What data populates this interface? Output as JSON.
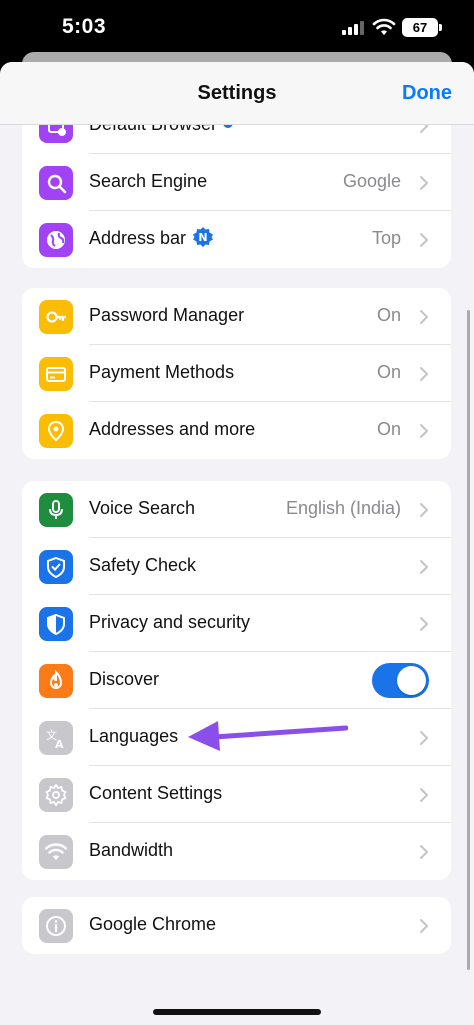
{
  "status_bar": {
    "time": "5:03",
    "battery": "67"
  },
  "nav": {
    "title": "Settings",
    "done_label": "Done"
  },
  "groups": [
    [
      {
        "label": "Default Browser",
        "value": "",
        "icon": "default-browser-icon",
        "color": "#a142f4",
        "badge": "new-dot"
      },
      {
        "label": "Search Engine",
        "value": "Google",
        "icon": "search-icon",
        "color": "#a142f4"
      },
      {
        "label": "Address bar",
        "value": "Top",
        "icon": "globe-icon",
        "color": "#a142f4",
        "badge": "new-badge",
        "badge_letter": "N"
      }
    ],
    [
      {
        "label": "Password Manager",
        "value": "On",
        "icon": "key-icon",
        "color": "#fbbc04"
      },
      {
        "label": "Payment Methods",
        "value": "On",
        "icon": "credit-card-icon",
        "color": "#fbbc04"
      },
      {
        "label": "Addresses and more",
        "value": "On",
        "icon": "location-pin-icon",
        "color": "#fbbc04"
      }
    ],
    [
      {
        "label": "Voice Search",
        "value": "English (India)",
        "icon": "microphone-icon",
        "color": "#1e8e3e"
      },
      {
        "label": "Safety Check",
        "value": "",
        "icon": "shield-check-icon",
        "color": "#1a73e8"
      },
      {
        "label": "Privacy and security",
        "value": "",
        "icon": "shield-icon",
        "color": "#1a73e8"
      },
      {
        "label": "Discover",
        "value": "",
        "icon": "flame-icon",
        "color": "#fa7b17",
        "toggle": true,
        "toggle_on": true
      },
      {
        "label": "Languages",
        "value": "",
        "icon": "translate-icon",
        "color": "#c7c7cc"
      },
      {
        "label": "Content Settings",
        "value": "",
        "icon": "gear-icon",
        "color": "#c7c7cc"
      },
      {
        "label": "Bandwidth",
        "value": "",
        "icon": "wifi-icon",
        "color": "#c7c7cc"
      }
    ],
    [
      {
        "label": "Google Chrome",
        "value": "",
        "icon": "info-icon",
        "color": "#c7c7cc"
      }
    ]
  ],
  "colors": {
    "accent": "#0a7aff",
    "toggle_on": "#1a73e8",
    "annotation_arrow": "#8a4fe8"
  }
}
